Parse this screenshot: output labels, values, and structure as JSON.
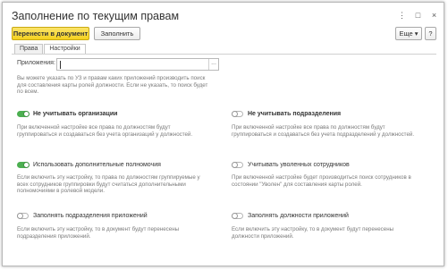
{
  "window": {
    "title": "Заполнение по текущим правам",
    "controls": [
      "⋮",
      "□",
      "×"
    ]
  },
  "toolbar": {
    "transfer_label": "Перенести в документ",
    "fill_label": "Заполнить",
    "more_label": "Еще ▾",
    "help_label": "?"
  },
  "tabs": [
    {
      "label": "Права",
      "active": false
    },
    {
      "label": "Настройки",
      "active": true
    }
  ],
  "applications": {
    "label": "Приложения:",
    "value": "",
    "choose_icon": "...",
    "hint": "Вы можете указать по УЗ и правам каких приложений производить поиск для составления карты ролей должности. Если не указать, то поиск будет по всем."
  },
  "options": [
    {
      "key": "ignore_orgs",
      "label": "Не учитывать организации",
      "on": true,
      "bold": true,
      "hint": "При включенной настройке все права по должностям будут группироваться и создаваться без учета организаций у должностей."
    },
    {
      "key": "ignore_depts",
      "label": "Не учитывать подразделения",
      "on": false,
      "bold": true,
      "hint": "При включенной настройке все права по должностям будут группироваться и создаваться без учета подразделений у должностей."
    },
    {
      "key": "use_extra_powers",
      "label": "Использовать дополнительные полномочия",
      "on": true,
      "bold": false,
      "hint": "Если включить эту настройку, то права по должностям группируемые у всех сотрудников группировки будут считаться дополнительными полномочиями в ролевой модели."
    },
    {
      "key": "count_dismissed",
      "label": "Учитывать уволенных сотрудников",
      "on": false,
      "bold": false,
      "hint": "При включенной настройке будет производиться поиск сотрудников в состоянии \"Уволен\" для составления карты ролей."
    },
    {
      "key": "fill_app_depts",
      "label": "Заполнять подразделения приложений",
      "on": false,
      "bold": false,
      "hint": "Если включить эту настройку, то в документ будут перенесены подразделения приложений."
    },
    {
      "key": "fill_app_positions",
      "label": "Заполнять должности приложений",
      "on": false,
      "bold": false,
      "hint": "Если включить эту настройку, то в документ будут перенесены должности приложений."
    }
  ],
  "colors": {
    "accent": "#f5d21f",
    "toggle_on": "#4caf50"
  }
}
